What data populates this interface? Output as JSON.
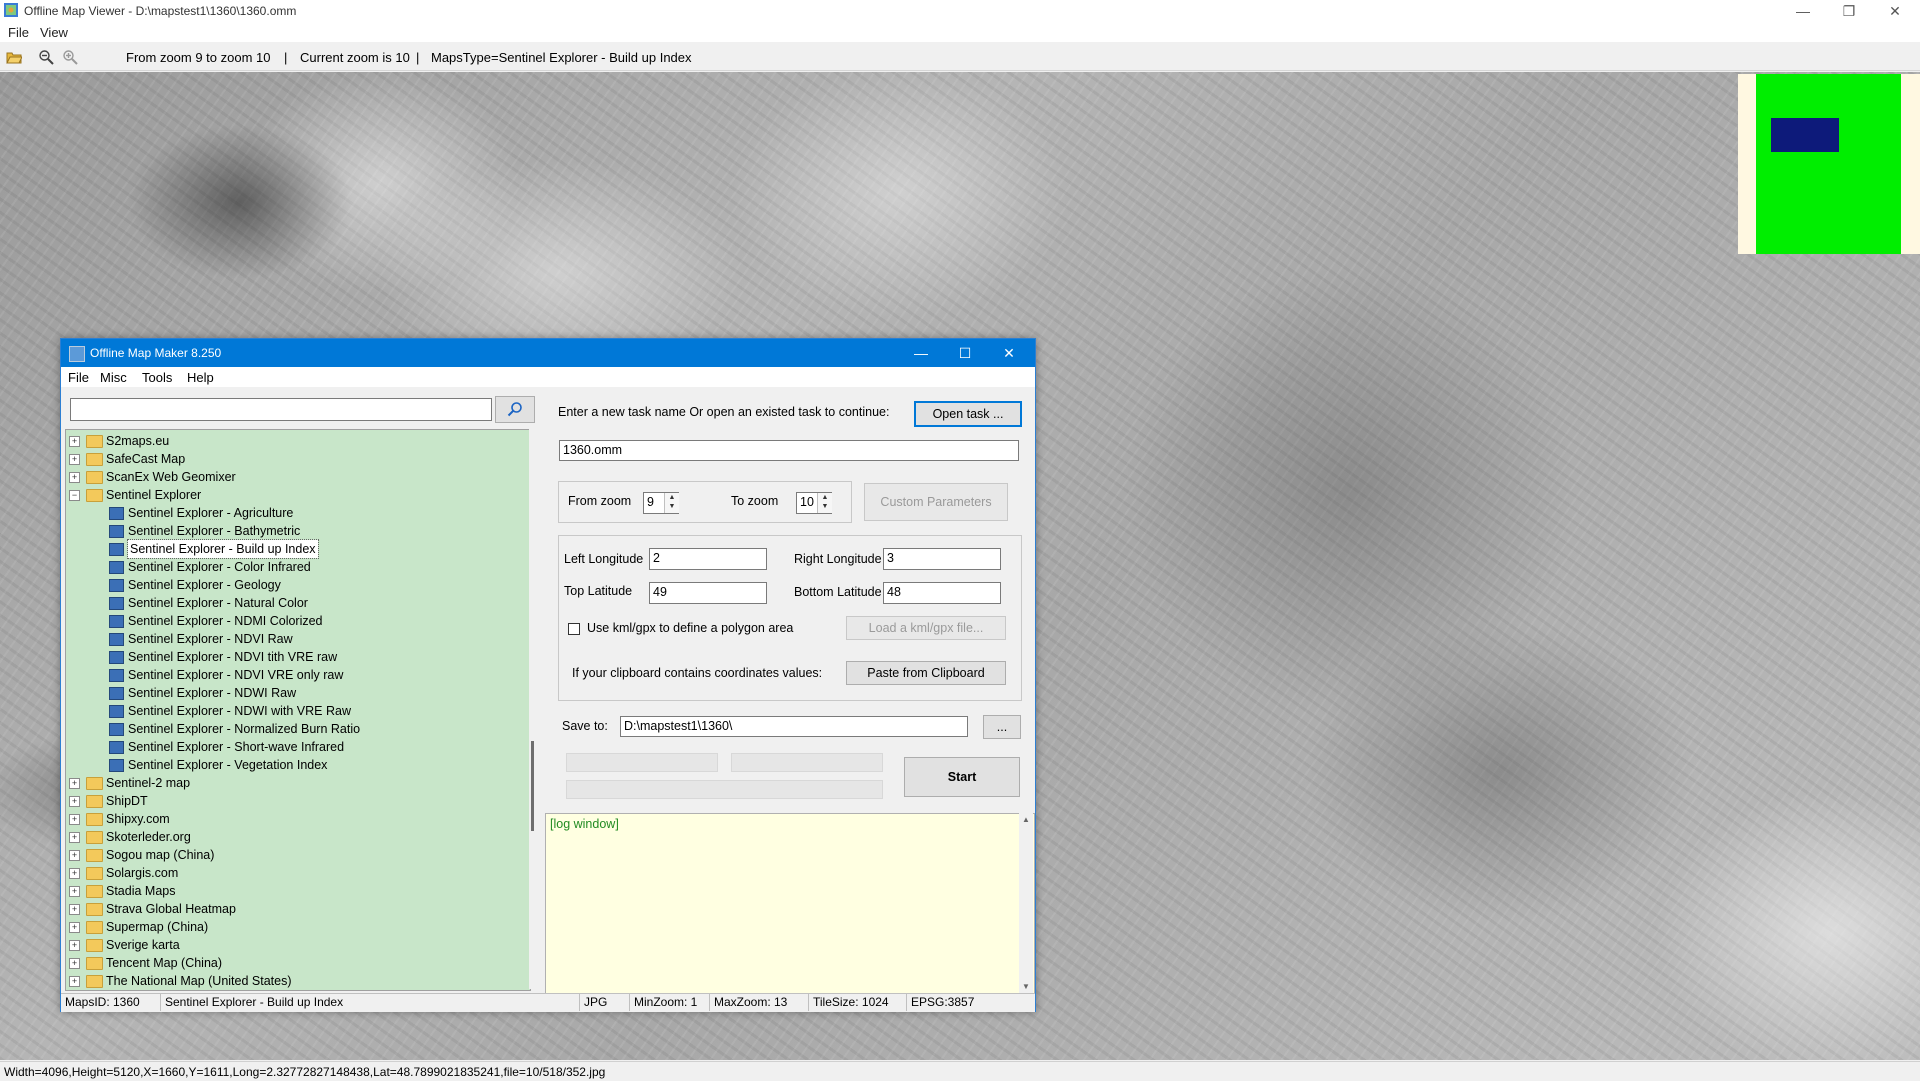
{
  "app": {
    "title": "Offline Map Viewer - D:\\mapstest1\\1360\\1360.omm",
    "window_buttons": [
      "—",
      "❐",
      "✕"
    ],
    "menu": [
      "File",
      "View"
    ],
    "toolbar": {
      "zoom_range": "From zoom 9 to zoom 10",
      "current_zoom": "Current zoom is 10",
      "maps_type": "MapsType=Sentinel Explorer - Build up Index",
      "separator": "|"
    },
    "status": "Width=4096,Height=5120,X=1660,Y=1611,Long=2.32772827148438,Lat=48.7899021835241,file=10/518/352.jpg"
  },
  "colors": {
    "accent": "#0078d7",
    "tree_bg": "#c8e6c9",
    "log_bg": "#ffffe1",
    "minimap_bg": "#00ee00",
    "minimap_view": "#0d1a7a"
  },
  "dialog": {
    "title": "Offline Map Maker 8.250",
    "window_buttons": [
      "—",
      "☐",
      "✕"
    ],
    "menu": [
      "File",
      "Misc",
      "Tools",
      "Help"
    ],
    "search": {
      "value": "",
      "icon": "search-icon"
    },
    "tree": [
      {
        "label": "S2maps.eu",
        "type": "folder",
        "expanded": false,
        "level": 0
      },
      {
        "label": "SafeCast Map",
        "type": "folder",
        "expanded": false,
        "level": 0
      },
      {
        "label": "ScanEx Web Geomixer",
        "type": "folder",
        "expanded": false,
        "level": 0
      },
      {
        "label": "Sentinel Explorer",
        "type": "folder",
        "expanded": true,
        "level": 0
      },
      {
        "label": "Sentinel Explorer - Agriculture",
        "type": "map",
        "level": 1
      },
      {
        "label": "Sentinel Explorer - Bathymetric",
        "type": "map",
        "level": 1
      },
      {
        "label": "Sentinel Explorer - Build up Index",
        "type": "map",
        "level": 1,
        "selected": true
      },
      {
        "label": "Sentinel Explorer - Color Infrared",
        "type": "map",
        "level": 1
      },
      {
        "label": "Sentinel Explorer - Geology",
        "type": "map",
        "level": 1
      },
      {
        "label": "Sentinel Explorer - Natural Color",
        "type": "map",
        "level": 1
      },
      {
        "label": "Sentinel Explorer - NDMI Colorized",
        "type": "map",
        "level": 1
      },
      {
        "label": "Sentinel Explorer - NDVI Raw",
        "type": "map",
        "level": 1
      },
      {
        "label": "Sentinel Explorer - NDVI tith VRE raw",
        "type": "map",
        "level": 1
      },
      {
        "label": "Sentinel Explorer - NDVI VRE only raw",
        "type": "map",
        "level": 1
      },
      {
        "label": "Sentinel Explorer - NDWI Raw",
        "type": "map",
        "level": 1
      },
      {
        "label": "Sentinel Explorer - NDWI with VRE Raw",
        "type": "map",
        "level": 1
      },
      {
        "label": "Sentinel Explorer - Normalized Burn Ratio",
        "type": "map",
        "level": 1
      },
      {
        "label": "Sentinel Explorer - Short-wave Infrared",
        "type": "map",
        "level": 1
      },
      {
        "label": "Sentinel Explorer - Vegetation Index",
        "type": "map",
        "level": 1
      },
      {
        "label": "Sentinel-2 map",
        "type": "folder",
        "expanded": false,
        "level": 0
      },
      {
        "label": "ShipDT",
        "type": "folder",
        "expanded": false,
        "level": 0
      },
      {
        "label": "Shipxy.com",
        "type": "folder",
        "expanded": false,
        "level": 0
      },
      {
        "label": "Skoterleder.org",
        "type": "folder",
        "expanded": false,
        "level": 0
      },
      {
        "label": "Sogou map (China)",
        "type": "folder",
        "expanded": false,
        "level": 0
      },
      {
        "label": "Solargis.com",
        "type": "folder",
        "expanded": false,
        "level": 0
      },
      {
        "label": "Stadia Maps",
        "type": "folder",
        "expanded": false,
        "level": 0
      },
      {
        "label": "Strava Global Heatmap",
        "type": "folder",
        "expanded": false,
        "level": 0
      },
      {
        "label": "Supermap (China)",
        "type": "folder",
        "expanded": false,
        "level": 0
      },
      {
        "label": "Sverige karta",
        "type": "folder",
        "expanded": false,
        "level": 0
      },
      {
        "label": "Tencent Map (China)",
        "type": "folder",
        "expanded": false,
        "level": 0
      },
      {
        "label": "The National Map (United States)",
        "type": "folder",
        "expanded": false,
        "level": 0
      }
    ],
    "task": {
      "prompt": "Enter a new task name Or open an existed task to continue:",
      "open_button": "Open task ...",
      "name_value": "1360.omm"
    },
    "zoom": {
      "from_label": "From zoom",
      "from_value": "9",
      "to_label": "To zoom",
      "to_value": "10",
      "custom_button": "Custom Parameters"
    },
    "coords": {
      "left_lon_label": "Left Longitude",
      "left_lon_value": "2",
      "right_lon_label": "Right Longitude",
      "right_lon_value": "3",
      "top_lat_label": "Top Latitude",
      "top_lat_value": "49",
      "bottom_lat_label": "Bottom Latitude",
      "bottom_lat_value": "48",
      "kml_checkbox_label": "Use kml/gpx to define a polygon area",
      "kml_checked": false,
      "kml_button": "Load a kml/gpx file...",
      "clipboard_label": "If your clipboard contains coordinates values:",
      "clipboard_button": "Paste from Clipboard"
    },
    "save": {
      "label": "Save to:",
      "value": "D:\\mapstest1\\1360\\",
      "browse_button": "...",
      "start_button": "Start"
    },
    "log": "[log window]",
    "status": {
      "maps_id": "MapsID: 1360",
      "maps_name": "Sentinel Explorer - Build up Index",
      "format": "JPG",
      "min_zoom": "MinZoom: 1",
      "max_zoom": "MaxZoom: 13",
      "tile_size": "TileSize: 1024",
      "epsg": "EPSG:3857"
    }
  }
}
